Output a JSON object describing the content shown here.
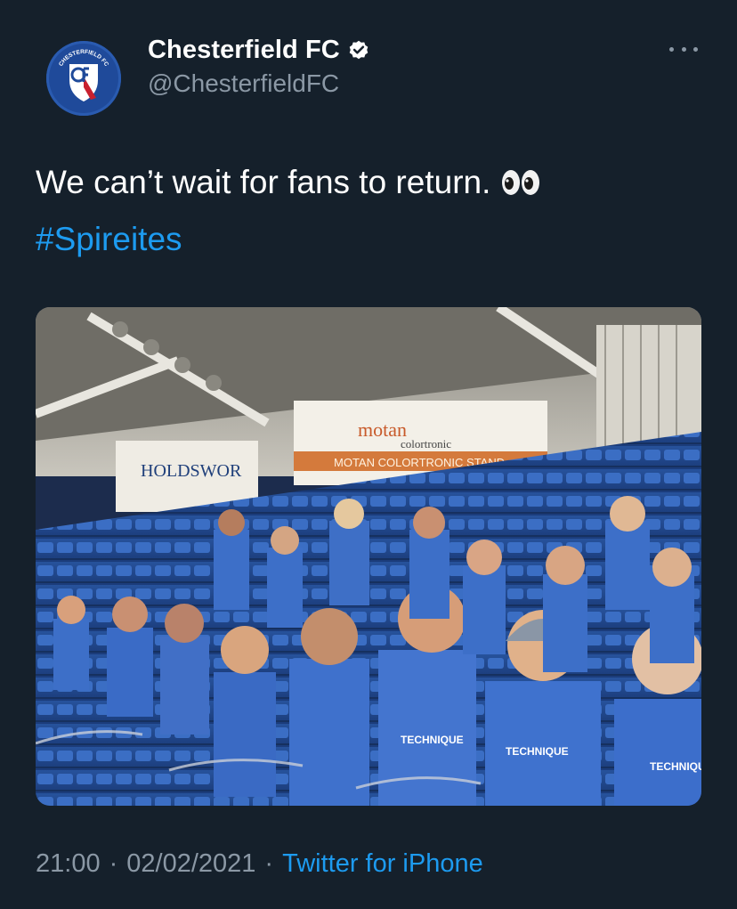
{
  "tweet": {
    "display_name": "Chesterfield FC",
    "handle": "@ChesterfieldFC",
    "text": "We can’t wait for fans to return.",
    "hashtag": "#Spireites",
    "time": "21:00",
    "date": "02/02/2021",
    "source": "Twitter for iPhone",
    "separator": "·"
  },
  "photo": {
    "signs": {
      "holdsworth": "HOLDSWOR",
      "motan": "motan",
      "colortronic": "colortronic",
      "stand": "MOTAN COLORTRONIC STAND"
    },
    "shirt_sponsor": "TECHNIQUE"
  },
  "avatar": {
    "badge_text": "CHESTERFIELD FC"
  },
  "icons": {
    "verified": "verified-badge-icon",
    "more": "more-options-icon",
    "eyes": "eyes-emoji-icon"
  },
  "colors": {
    "background": "#15202b",
    "link": "#1d9bf0",
    "muted": "#8b98a5",
    "seat_blue": "#2d5fb8"
  }
}
